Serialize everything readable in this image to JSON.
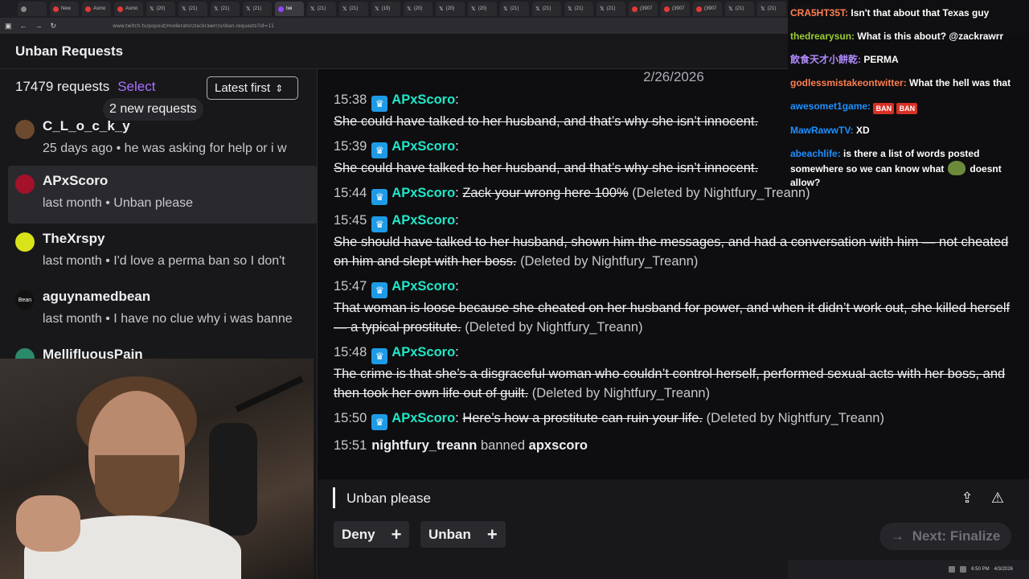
{
  "browser": {
    "tabs": [
      {
        "label": "",
        "icon": "chrome-icon"
      },
      {
        "label": "New",
        "icon": "youtube-icon"
      },
      {
        "label": "Asmo",
        "icon": "youtube-icon"
      },
      {
        "label": "Asmo",
        "icon": "youtube-icon"
      },
      {
        "label": "(20)",
        "icon": "x-icon"
      },
      {
        "label": "(21)",
        "icon": "x-icon"
      },
      {
        "label": "(21)",
        "icon": "x-icon"
      },
      {
        "label": "(21)",
        "icon": "x-icon"
      },
      {
        "label": "twi",
        "icon": "twitch-icon"
      },
      {
        "label": "(21)",
        "icon": "x-icon"
      },
      {
        "label": "(21)",
        "icon": "x-icon"
      },
      {
        "label": "(19)",
        "icon": "x-icon"
      },
      {
        "label": "(20)",
        "icon": "x-icon"
      },
      {
        "label": "(20)",
        "icon": "x-icon"
      },
      {
        "label": "(20)",
        "icon": "x-icon"
      },
      {
        "label": "(21)",
        "icon": "x-icon"
      },
      {
        "label": "(21)",
        "icon": "x-icon"
      },
      {
        "label": "(21)",
        "icon": "x-icon"
      },
      {
        "label": "(21)",
        "icon": "x-icon"
      },
      {
        "label": "(3907",
        "icon": "youtube-icon"
      },
      {
        "label": "(3907",
        "icon": "youtube-icon"
      },
      {
        "label": "(3907",
        "icon": "youtube-icon"
      },
      {
        "label": "(21)",
        "icon": "x-icon"
      },
      {
        "label": "(21)",
        "icon": "x-icon"
      },
      {
        "label": "(3907",
        "icon": "youtube-icon"
      }
    ],
    "url": "www.twitch.tv/popout/moderator/zackrawrr/unban-requests?id=11"
  },
  "header": {
    "title": "Unban Requests"
  },
  "list": {
    "count": "17479 requests",
    "select_label": "Select",
    "sort_label": "Latest first",
    "new_pill": "2 new requests",
    "items": [
      {
        "name": "C_L_o_c_k_y",
        "sub": "25 days ago • he was asking for help or i w",
        "avatar_color": "#6b4a2f"
      },
      {
        "name": "APxScoro",
        "sub": "last month • Unban please",
        "avatar_color": "#a3122a"
      },
      {
        "name": "TheXrspy",
        "sub": "last month • I'd love a perma ban so I don't",
        "avatar_color": "#d8e31a"
      },
      {
        "name": "aguynamedbean",
        "sub": "last month • I have no clue why i was banne",
        "avatar_color": "#111111",
        "avatar_text": "Bean"
      },
      {
        "name": "MellifluousPain",
        "sub": "",
        "avatar_color": "#2a8a6a"
      }
    ]
  },
  "conversation": {
    "date": "2/26/2026",
    "messages": [
      {
        "time": "15:38",
        "user": "APxScoro",
        "text": "She could have talked to her husband, and that’s why she isn’t innocent.",
        "note": "(Deleted by Nightfury_Treann)"
      },
      {
        "time": "15:39",
        "user": "APxScoro",
        "text": "She could have talked to her husband, and that’s why she isn’t innocent.",
        "note": "(Deleted by Nightfury_Treann)"
      },
      {
        "time": "15:44",
        "user": "APxScoro",
        "text": "Zack your wrong here 100%",
        "note": "(Deleted by Nightfury_Treann)"
      },
      {
        "time": "15:45",
        "user": "APxScoro",
        "text": "She should have talked to her husband, shown him the messages, and had a conversation with him — not cheated on him and slept with her boss.",
        "note": "(Deleted by Nightfury_Treann)"
      },
      {
        "time": "15:47",
        "user": "APxScoro",
        "text": "That woman is loose because she cheated on her husband for power, and when it didn’t work out, she killed herself — a typical prostitute.",
        "note": "(Deleted by Nightfury_Treann)"
      },
      {
        "time": "15:48",
        "user": "APxScoro",
        "text": "The crime is that she’s a disgraceful woman who couldn’t control herself, performed sexual acts with her boss, and then took her own life out of guilt.",
        "note": "(Deleted by Nightfury_Treann)"
      },
      {
        "time": "15:50",
        "user": "APxScoro",
        "text": "Here’s how a prostitute can ruin your life.",
        "note": "(Deleted by Nightfury_Treann)"
      }
    ],
    "ban_event": {
      "time": "15:51",
      "moderator": "nightfury_treann",
      "action": "banned",
      "target": "apxscoro"
    }
  },
  "actions": {
    "reason": "Unban please",
    "deny_label": "Deny",
    "unban_label": "Unban",
    "next_label": "Next: Finalize",
    "share_icon": "share-icon",
    "report_icon": "report-icon"
  },
  "stream_chat": {
    "lines": [
      {
        "user": "CRA5HT35T:",
        "color": "#ff7f50",
        "text": "Isn't that about that Texas guy"
      },
      {
        "user": "thedrearysun:",
        "color": "#9acd32",
        "text": "What is this about? @zackrawrr"
      },
      {
        "user": "飲食天才小餅乾:",
        "color": "#b28cff",
        "text": "PERMA"
      },
      {
        "user": "godlessmistakeontwitter:",
        "color": "#ff7f50",
        "text": "What the hell was that"
      },
      {
        "user": "awesomet1game:",
        "color": "#1e90ff",
        "text": "",
        "emotes": [
          "BAN",
          "BAN"
        ]
      },
      {
        "user": "MawRawwTV:",
        "color": "#1e90ff",
        "text": "XD"
      },
      {
        "user": "abeachlife:",
        "color": "#1e90ff",
        "text": "is there a list of words posted"
      },
      {
        "user": "",
        "color": "#ffffff",
        "text": "somewhere so we can know what",
        "text2": "doesnt allow?"
      }
    ]
  },
  "taskbar": {
    "time": "6:50 PM",
    "date": "4/3/2026"
  },
  "colors": {
    "accent": "#a970ff",
    "username": "#1ee8c8",
    "badge": "#1e9be6",
    "background": "#0e0e10",
    "panel": "#18181b"
  }
}
